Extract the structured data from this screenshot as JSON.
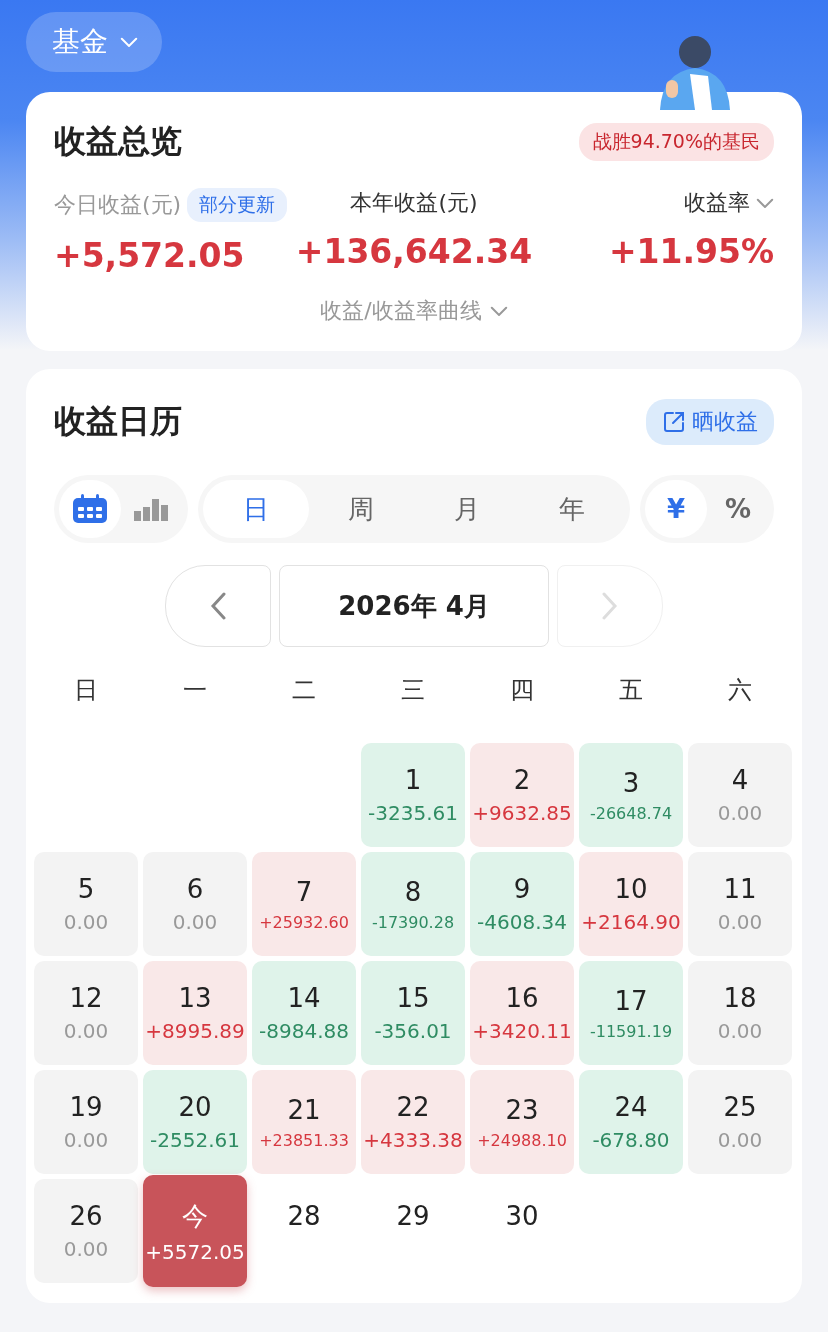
{
  "account_switch": {
    "label": "基金"
  },
  "overview": {
    "title": "收益总览",
    "rank_badge": "战胜94.70%的基民",
    "metrics": [
      {
        "label": "今日收益(元)",
        "tag": "部分更新",
        "value": "+5,572.05",
        "has_dropdown": false
      },
      {
        "label": "本年收益(元)",
        "value": "+136,642.34",
        "has_dropdown": false
      },
      {
        "label": "收益率",
        "value": "+11.95%",
        "has_dropdown": true
      }
    ],
    "curve_toggle": "收益/收益率曲线"
  },
  "calendar": {
    "title": "收益日历",
    "share_button": "晒收益",
    "view_modes": [
      {
        "kind": "calendar",
        "selected": true
      },
      {
        "kind": "bars",
        "selected": false
      }
    ],
    "periods": [
      {
        "label": "日",
        "selected": true
      },
      {
        "label": "周",
        "selected": false
      },
      {
        "label": "月",
        "selected": false
      },
      {
        "label": "年",
        "selected": false
      }
    ],
    "units": [
      {
        "label": "¥",
        "selected": true
      },
      {
        "label": "%",
        "selected": false
      }
    ],
    "month": "2026年 4月",
    "next_disabled": true,
    "weekdays": [
      "日",
      "一",
      "二",
      "三",
      "四",
      "五",
      "六"
    ],
    "weeks": [
      [
        {
          "kind": "empty"
        },
        {
          "kind": "empty"
        },
        {
          "kind": "empty"
        },
        {
          "kind": "loss",
          "day": "1",
          "amount": "-3235.61"
        },
        {
          "kind": "gain",
          "day": "2",
          "amount": "+9632.85"
        },
        {
          "kind": "loss",
          "day": "3",
          "amount": "-26648.74"
        },
        {
          "kind": "zero",
          "day": "4",
          "amount": "0.00"
        }
      ],
      [
        {
          "kind": "zero",
          "day": "5",
          "amount": "0.00"
        },
        {
          "kind": "zero",
          "day": "6",
          "amount": "0.00"
        },
        {
          "kind": "gain",
          "day": "7",
          "amount": "+25932.60"
        },
        {
          "kind": "loss",
          "day": "8",
          "amount": "-17390.28"
        },
        {
          "kind": "loss",
          "day": "9",
          "amount": "-4608.34"
        },
        {
          "kind": "gain",
          "day": "10",
          "amount": "+2164.90"
        },
        {
          "kind": "zero",
          "day": "11",
          "amount": "0.00"
        }
      ],
      [
        {
          "kind": "zero",
          "day": "12",
          "amount": "0.00"
        },
        {
          "kind": "gain",
          "day": "13",
          "amount": "+8995.89"
        },
        {
          "kind": "loss",
          "day": "14",
          "amount": "-8984.88"
        },
        {
          "kind": "loss",
          "day": "15",
          "amount": "-356.01"
        },
        {
          "kind": "gain",
          "day": "16",
          "amount": "+3420.11"
        },
        {
          "kind": "loss",
          "day": "17",
          "amount": "-11591.19"
        },
        {
          "kind": "zero",
          "day": "18",
          "amount": "0.00"
        }
      ],
      [
        {
          "kind": "zero",
          "day": "19",
          "amount": "0.00"
        },
        {
          "kind": "loss",
          "day": "20",
          "amount": "-2552.61"
        },
        {
          "kind": "gain",
          "day": "21",
          "amount": "+23851.33"
        },
        {
          "kind": "gain",
          "day": "22",
          "amount": "+4333.38"
        },
        {
          "kind": "gain",
          "day": "23",
          "amount": "+24988.10"
        },
        {
          "kind": "loss",
          "day": "24",
          "amount": "-678.80"
        },
        {
          "kind": "zero",
          "day": "25",
          "amount": "0.00"
        }
      ],
      [
        {
          "kind": "zero",
          "day": "26",
          "amount": "0.00"
        },
        {
          "kind": "today",
          "day": "今",
          "amount": "+5572.05"
        },
        {
          "kind": "future",
          "day": "28"
        },
        {
          "kind": "future",
          "day": "29"
        },
        {
          "kind": "future",
          "day": "30"
        },
        {
          "kind": "empty"
        },
        {
          "kind": "empty"
        }
      ]
    ]
  }
}
